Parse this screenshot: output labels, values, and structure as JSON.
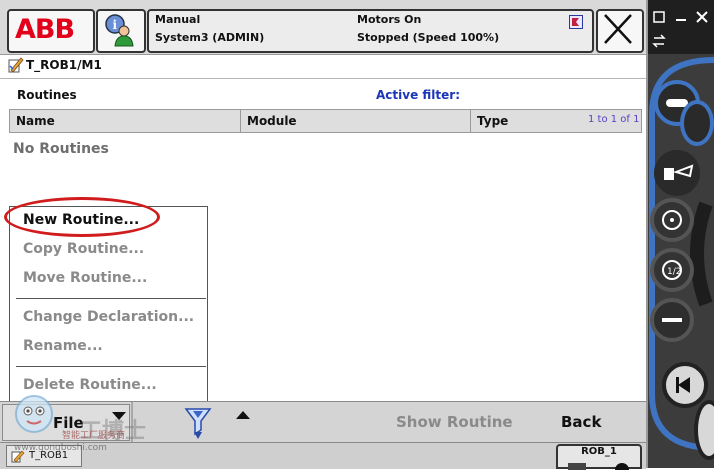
{
  "topbar": {
    "logo": "ABB",
    "mode": "Manual",
    "system": "System3 (ADMIN)",
    "motors": "Motors On",
    "state": "Stopped (Speed 100%)"
  },
  "path": "T_ROB1/M1",
  "routines": {
    "title": "Routines",
    "filter_label": "Active filter:",
    "columns": [
      "Name",
      "Module",
      "Type"
    ],
    "pager": "1 to 1 of 1",
    "empty_text": "No Routines"
  },
  "menu": {
    "items": [
      {
        "label": "New Routine...",
        "enabled": true
      },
      {
        "label": "Copy Routine...",
        "enabled": false
      },
      {
        "label": "Move Routine...",
        "enabled": false
      },
      {
        "label": "Change Declaration...",
        "enabled": false
      },
      {
        "label": "Rename...",
        "enabled": false
      },
      {
        "label": "Delete Routine...",
        "enabled": false
      }
    ]
  },
  "commands": {
    "file": "File",
    "show_routine": "Show Routine",
    "back": "Back"
  },
  "taskbar": {
    "task": "T_ROB1",
    "robot": "ROB_1"
  },
  "watermark": {
    "text": "工博士",
    "sub": "智能工厂服务商",
    "url": "www.gongboshi.com"
  },
  "colors": {
    "abb_red": "#e2001a",
    "filter_blue": "#1a35b8",
    "highlight_ring": "#d01c1c",
    "pendant_blue": "#3f74c2"
  },
  "icons": [
    "abb-logo",
    "info-user-icon",
    "warning-flag-icon",
    "close-icon",
    "program-editor-icon",
    "chevron-down-icon",
    "chevron-up-icon",
    "funnel-icon",
    "robot-task-icon"
  ]
}
